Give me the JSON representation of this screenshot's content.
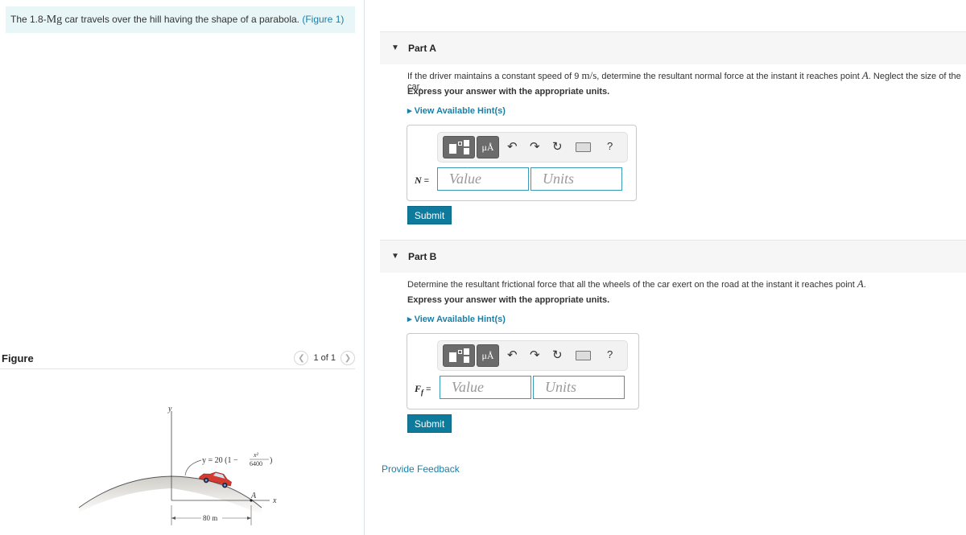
{
  "problem": {
    "text_before": "The 1.8-",
    "mass_unit": "Mg",
    "text_after": " car travels over the hill having the shape of a parabola. ",
    "figure_link": "(Figure 1)"
  },
  "figure_panel": {
    "title": "Figure",
    "pager_text": "1 of 1",
    "prev_icon": "chevron-left-icon",
    "next_icon": "chevron-right-icon",
    "diagram": {
      "y_axis_label": "y",
      "x_axis_label": "x",
      "equation_prefix": "y = 20 (1 −",
      "equation_numerator": "x²",
      "equation_denominator": "6400",
      "equation_suffix": ")",
      "point_label": "A",
      "dimension_label": "80 m",
      "car_color": "#d43a2f"
    }
  },
  "parts": [
    {
      "label": "Part A",
      "question_pre": "If the driver maintains a constant speed of 9 ",
      "question_unit": "m/s",
      "question_mid": ", determine the resultant normal force at the instant it reaches point ",
      "question_point": "A",
      "question_post": ". Neglect the size of the car.",
      "instruction": "Express your answer with the appropriate units.",
      "hint": "View Available Hint(s)",
      "variable": "N",
      "variable_sub": "",
      "value_placeholder": "Value",
      "units_placeholder": "Units",
      "submit": "Submit"
    },
    {
      "label": "Part B",
      "question_pre": "Determine the resultant frictional force that all the wheels of the car exert on the road at the instant it reaches point ",
      "question_point": "A",
      "question_post": ".",
      "instruction": "Express your answer with the appropriate units.",
      "hint": "View Available Hint(s)",
      "variable": "F",
      "variable_sub": "f",
      "value_placeholder": "Value",
      "units_placeholder": "Units",
      "submit": "Submit"
    }
  ],
  "toolbar": {
    "templates_icon": "fraction-template-icon",
    "units_button_label": "μÅ",
    "undo_icon": "undo-icon",
    "redo_icon": "redo-icon",
    "reset_icon": "reset-icon",
    "keyboard_icon": "keyboard-icon",
    "help_label": "?"
  },
  "feedback_link": "Provide Feedback",
  "colors": {
    "accent": "#1a7fa6",
    "submit_bg": "#0e7a9c",
    "problem_bg": "#e8f6f8"
  }
}
